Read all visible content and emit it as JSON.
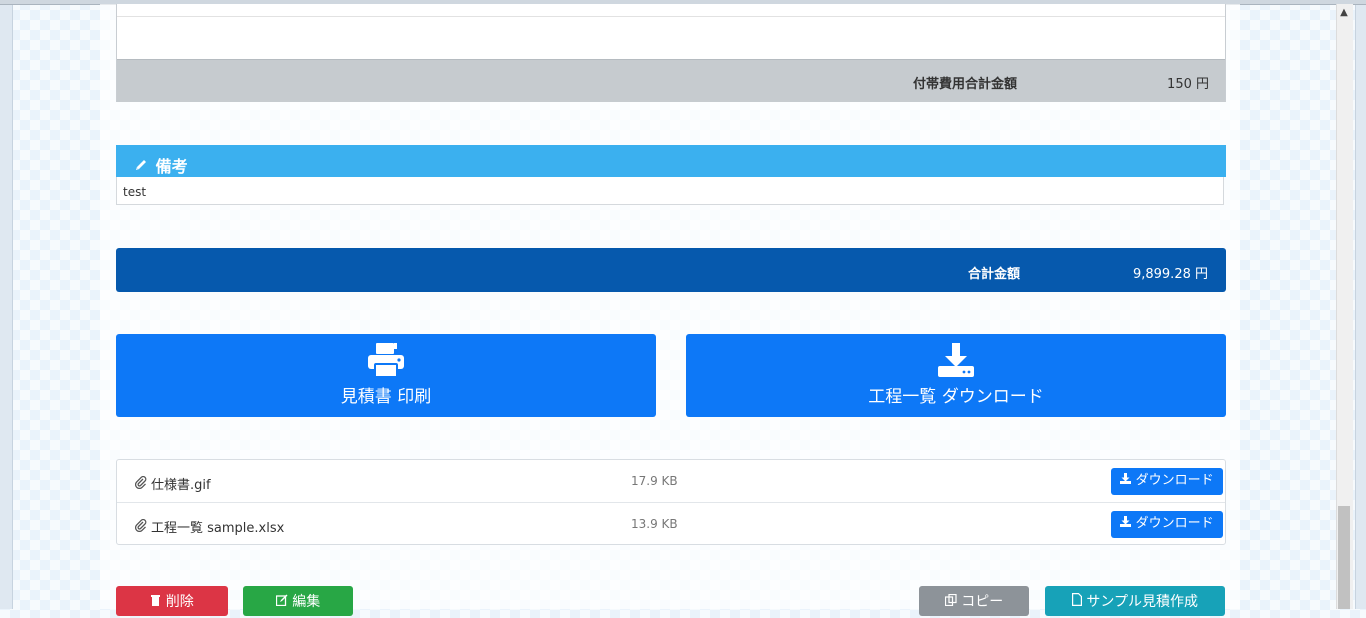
{
  "summary": {
    "subtotal_label": "付帯費用合計金額",
    "subtotal_value": "150 円"
  },
  "remarks": {
    "title": "備考",
    "body": "test",
    "icon": "pencil-icon"
  },
  "total": {
    "label": "合計金額",
    "value": "9,899.28 円"
  },
  "actions": {
    "print_label": "見積書 印刷",
    "print_icon": "printer-icon",
    "download_label": "工程一覧 ダウンロード",
    "download_icon": "download-icon"
  },
  "files": [
    {
      "name": "仕様書.gif",
      "size": "17.9 KB",
      "button": "ダウンロード"
    },
    {
      "name": "工程一覧 sample.xlsx",
      "size": "13.9 KB",
      "button": "ダウンロード"
    }
  ],
  "bottom_buttons": {
    "delete": "削除",
    "edit": "編集",
    "copy": "コピー",
    "sample": "サンプル見積作成"
  },
  "colors": {
    "remarks_header": "#3bb0ef",
    "total_bar": "#0659ad",
    "primary_button": "#0d78f7",
    "delete": "#dc3545",
    "edit": "#28a745",
    "copy": "#8d9399",
    "sample": "#17a2b8"
  }
}
